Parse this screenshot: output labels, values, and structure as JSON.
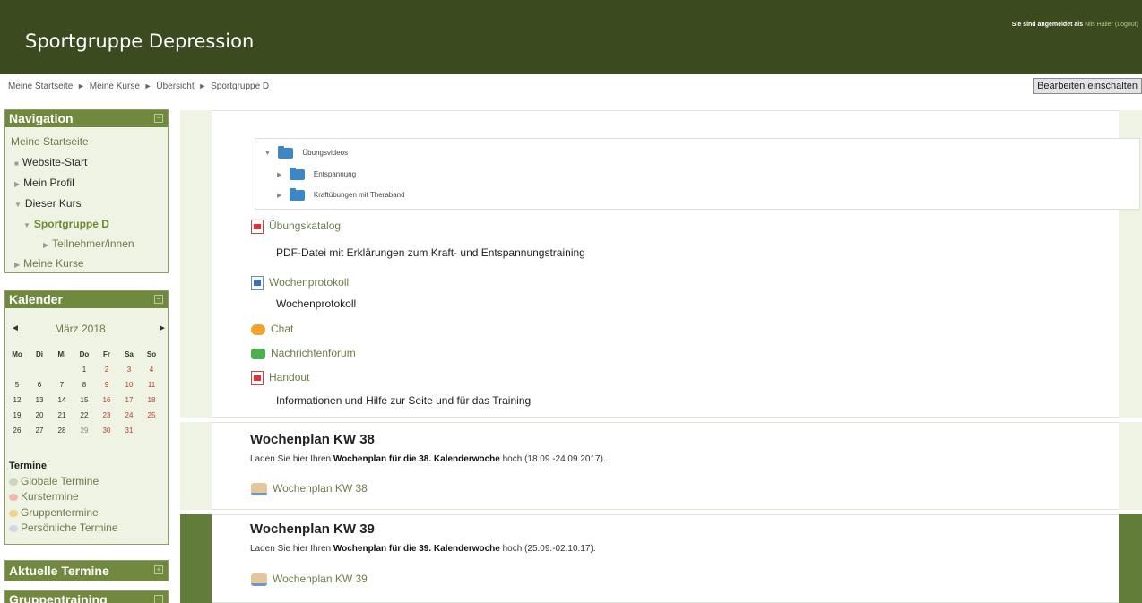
{
  "header": {
    "site_title": "Sportgruppe Depression",
    "login_prefix": "Sie sind angemeldet als",
    "user_name": "Nils Haller",
    "logout": "(Logout)"
  },
  "breadcrumb": {
    "items": [
      "Meine Startseite",
      "Meine Kurse",
      "Übersicht",
      "Sportgruppe D"
    ],
    "separator": "►"
  },
  "edit_button": "Bearbeiten einschalten",
  "navigation": {
    "title": "Navigation",
    "items": [
      "Meine Startseite",
      "Website-Start",
      "Mein Profil",
      "Dieser Kurs",
      "Sportgruppe D",
      "Teilnehmer/innen",
      "Meine Kurse"
    ]
  },
  "calendar": {
    "title": "Kalender",
    "month": "März 2018",
    "prev_icon": "◄",
    "next_icon": "►",
    "weekdays": [
      "Mo",
      "Di",
      "Mi",
      "Do",
      "Fr",
      "Sa",
      "So"
    ],
    "weeks": [
      [
        "",
        "",
        "",
        "1",
        "2",
        "3",
        "4"
      ],
      [
        "5",
        "6",
        "7",
        "8",
        "9",
        "10",
        "11"
      ],
      [
        "12",
        "13",
        "14",
        "15",
        "16",
        "17",
        "18"
      ],
      [
        "19",
        "20",
        "21",
        "22",
        "23",
        "24",
        "25"
      ],
      [
        "26",
        "27",
        "28",
        "29",
        "30",
        "31",
        ""
      ]
    ],
    "termine_title": "Termine",
    "termine": [
      "Globale Termine",
      "Kurstermine",
      "Gruppentermine",
      "Persönliche Termine"
    ]
  },
  "blocks": {
    "aktuelle_termine": "Aktuelle Termine",
    "gruppentraining": "Gruppentraining"
  },
  "course": {
    "folder_tree": {
      "root": "Übungsvideos",
      "children": [
        "Entspannung",
        "Kraftübungen mit Theraband"
      ]
    },
    "activities": {
      "uebungskatalog": "Übungskatalog",
      "uebungskatalog_desc": "PDF-Datei mit Erklärungen zum Kraft- und Entspannungstraining",
      "wochenprotokoll": "Wochenprotokoll",
      "wochenprotokoll_desc": "Wochenprotokoll",
      "chat": "Chat",
      "forum": "Nachrichtenforum",
      "handout": "Handout",
      "handout_desc": "Informationen und Hilfe zur Seite und für das Training"
    },
    "week38": {
      "title": "Wochenplan KW 38",
      "desc_pre": "Laden Sie hier Ihren",
      "desc_bold": "Wochenplan für die 38. Kalenderwoche",
      "desc_post": "hoch (18.09.-24.09.2017).",
      "link": "Wochenplan KW 38"
    },
    "week39": {
      "title": "Wochenplan KW 39",
      "desc_pre": "Laden Sie hier Ihren",
      "desc_bold": "Wochenplan für die 39. Kalenderwoche",
      "desc_post": "hoch (25.09.-02.10.17).",
      "link": "Wochenplan KW 39"
    }
  },
  "colors": {
    "header_bg": "#3c4a1f",
    "block_head": "#71893f",
    "active_section": "#627d3a",
    "link_green": "#6d7d4a"
  }
}
